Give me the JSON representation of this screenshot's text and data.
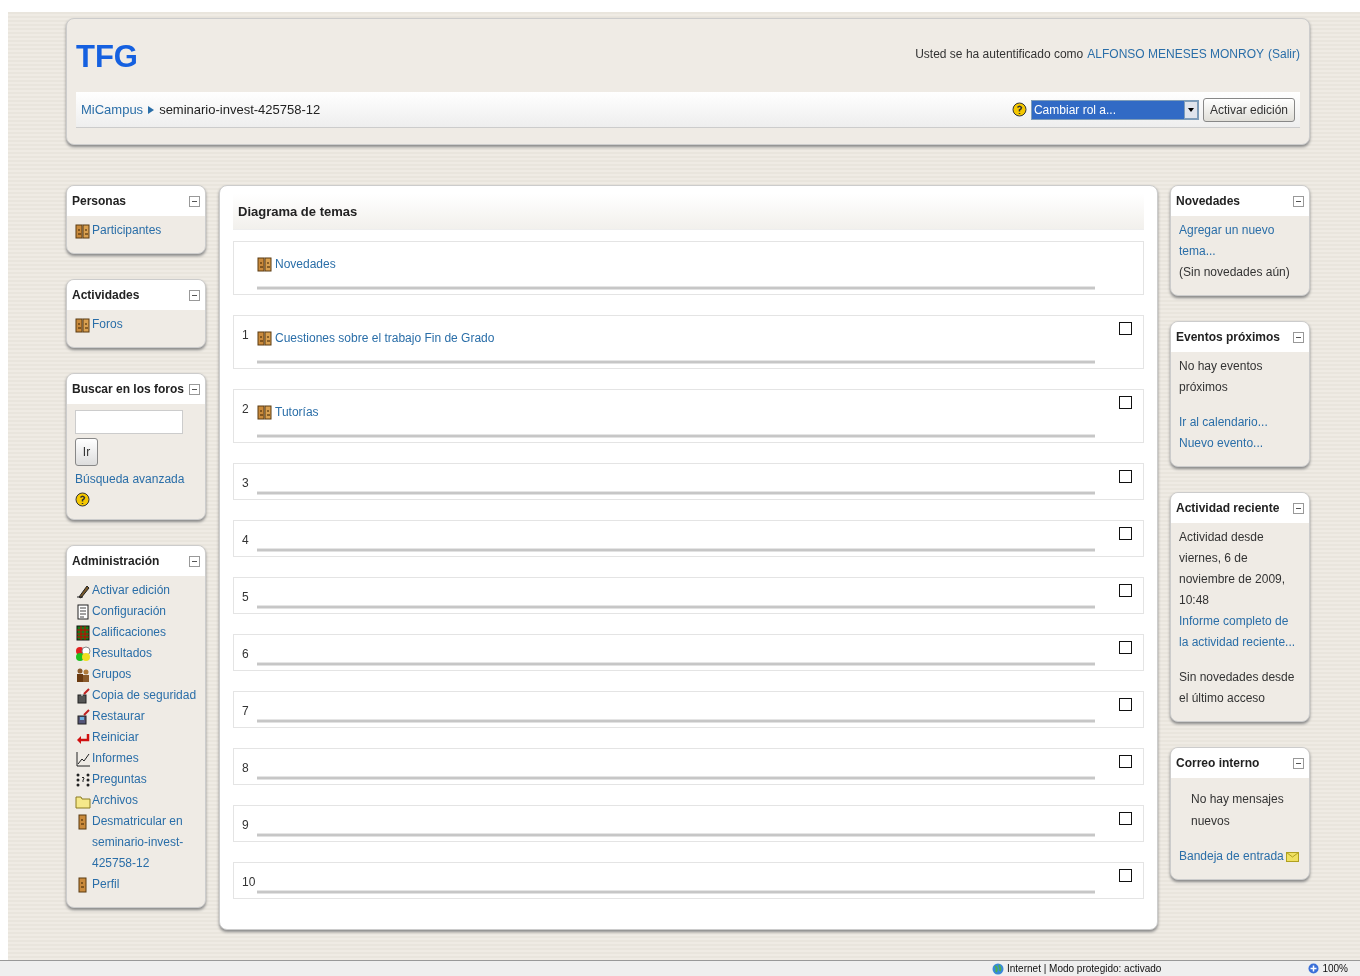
{
  "header": {
    "site_title": "TFG",
    "login_prefix": "Usted se ha autentificado como",
    "user": "ALFONSO MENESES MONROY",
    "logout": "(Salir)"
  },
  "breadcrumb": [
    {
      "label": "MiCampus",
      "link": true
    },
    {
      "label": "seminario-invest-425758-12",
      "link": false
    }
  ],
  "role_select": {
    "value": "Cambiar rol a..."
  },
  "edit_button": "Activar edición",
  "left_blocks": [
    {
      "kind": "links",
      "title": "Personas",
      "items": [
        {
          "label": "Participantes"
        }
      ]
    },
    {
      "kind": "links",
      "title": "Actividades",
      "items": [
        {
          "label": "Foros"
        }
      ]
    },
    {
      "kind": "search",
      "title": "Buscar en los foros",
      "button": "Ir",
      "link": "Búsqueda avanzada"
    },
    {
      "kind": "links",
      "title": "Administración",
      "items": [
        {
          "label": "Activar edición"
        },
        {
          "label": "Configuración"
        },
        {
          "label": "Calificaciones"
        },
        {
          "label": "Resultados"
        },
        {
          "label": "Grupos"
        },
        {
          "label": "Copia de seguridad"
        },
        {
          "label": "Restaurar"
        },
        {
          "label": "Reiniciar"
        },
        {
          "label": "Informes"
        },
        {
          "label": "Preguntas"
        },
        {
          "label": "Archivos"
        },
        {
          "label": "Desmatricular en seminario-invest-425758-12"
        },
        {
          "label": "Perfil"
        }
      ]
    }
  ],
  "main": {
    "title": "Diagrama de temas",
    "sections": [
      {
        "items": [
          {
            "label": "Novedades"
          }
        ]
      },
      {
        "number": "1",
        "checked": false,
        "items": [
          {
            "label": "Cuestiones sobre el trabajo Fin de Grado"
          }
        ]
      },
      {
        "number": "2",
        "checked": false,
        "items": [
          {
            "label": "Tutorías"
          }
        ]
      },
      {
        "number": "3",
        "checked": false
      },
      {
        "number": "4",
        "checked": false
      },
      {
        "number": "5",
        "checked": false
      },
      {
        "number": "6",
        "checked": false
      },
      {
        "number": "7",
        "checked": false
      },
      {
        "number": "8",
        "checked": false
      },
      {
        "number": "9",
        "checked": false
      },
      {
        "number": "10",
        "checked": false
      }
    ]
  },
  "right_blocks": [
    {
      "title": "Novedades",
      "items": [
        {
          "kind": "link",
          "text": "Agregar un nuevo tema..."
        },
        {
          "kind": "text",
          "text": "(Sin novedades aún)"
        }
      ]
    },
    {
      "title": "Eventos próximos",
      "items": [
        {
          "kind": "text",
          "text": "No hay eventos próximos"
        },
        {
          "kind": "gap"
        },
        {
          "kind": "link",
          "text": "Ir al calendario..."
        },
        {
          "kind": "link",
          "text": "Nuevo evento..."
        }
      ]
    },
    {
      "title": "Actividad reciente",
      "items": [
        {
          "kind": "text",
          "text": "Actividad desde viernes, 6 de noviembre de 2009, 10:48"
        },
        {
          "kind": "link",
          "text": "Informe completo de la actividad reciente..."
        },
        {
          "kind": "gap"
        },
        {
          "kind": "text",
          "text": "Sin novedades desde el último acceso"
        }
      ]
    },
    {
      "title": "Correo interno",
      "items": [
        {
          "kind": "centered",
          "text": "No hay mensajes nuevos"
        },
        {
          "kind": "gap"
        },
        {
          "kind": "mail",
          "text": "Bandeja de entrada"
        }
      ]
    }
  ],
  "status_bar": {
    "zone": "Internet | Modo protegido: activado",
    "zoom": "100%"
  }
}
